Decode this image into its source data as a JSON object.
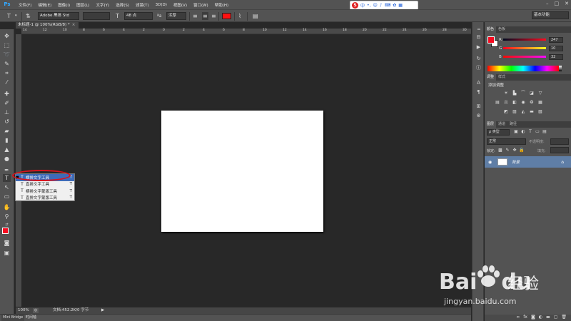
{
  "menubar": {
    "logo": "Ps",
    "items": [
      "文件(F)",
      "编辑(E)",
      "图像(I)",
      "图层(L)",
      "文字(Y)",
      "选择(S)",
      "滤镜(T)",
      "3D(D)",
      "视图(V)",
      "窗口(W)",
      "帮助(H)"
    ],
    "window_controls": [
      "–",
      "□",
      "✕"
    ]
  },
  "ime": {
    "logo": "S",
    "mode": "中"
  },
  "options": {
    "font_family": "Adobe 黑体 Std",
    "font_size": "48 点",
    "antialias": "浑厚",
    "color": "#ff1010",
    "workspace": "基本功能"
  },
  "document": {
    "tab_title": "未标题-1 @ 100%(RGB/8) *",
    "close_glyph": "×",
    "ruler_ticks": [
      "14",
      "12",
      "10",
      "8",
      "6",
      "4",
      "2",
      "0",
      "2",
      "4",
      "6",
      "8",
      "10",
      "12",
      "14",
      "16",
      "18",
      "20",
      "22",
      "24",
      "26",
      "28",
      "30"
    ]
  },
  "flyout": {
    "items": [
      {
        "label": "横排文字工具",
        "key": "T"
      },
      {
        "label": "直排文字工具",
        "key": "T"
      },
      {
        "label": "横排文字蒙版工具",
        "key": "T"
      },
      {
        "label": "直排文字蒙版工具",
        "key": "T"
      }
    ]
  },
  "status": {
    "zoom": "100%",
    "doc_size": "文档:452.2K/0 字节",
    "arrow": "▶"
  },
  "bottom_tabs": [
    "Mini Bridge",
    "时间轴"
  ],
  "color_panel": {
    "tabs": [
      "颜色",
      "色板"
    ],
    "r": "247",
    "g": "10",
    "b": "32",
    "labels": [
      "R",
      "G",
      "B"
    ],
    "foreground": "#f70a20"
  },
  "adjust_panel": {
    "tabs": [
      "调整",
      "样式"
    ],
    "title": "添加调整"
  },
  "layers_panel": {
    "tabs": [
      "图层",
      "通道",
      "路径"
    ],
    "kind": "ρ 类型",
    "blend_mode": "正常",
    "opacity_label": "不透明度:",
    "lock_label": "锁定:",
    "fill_label": "填充:",
    "layer_name": "背景"
  },
  "watermark": {
    "brand": "Bai",
    "brand_suffix": "du",
    "cn": "经验",
    "url": "jingyan.baidu.com"
  }
}
